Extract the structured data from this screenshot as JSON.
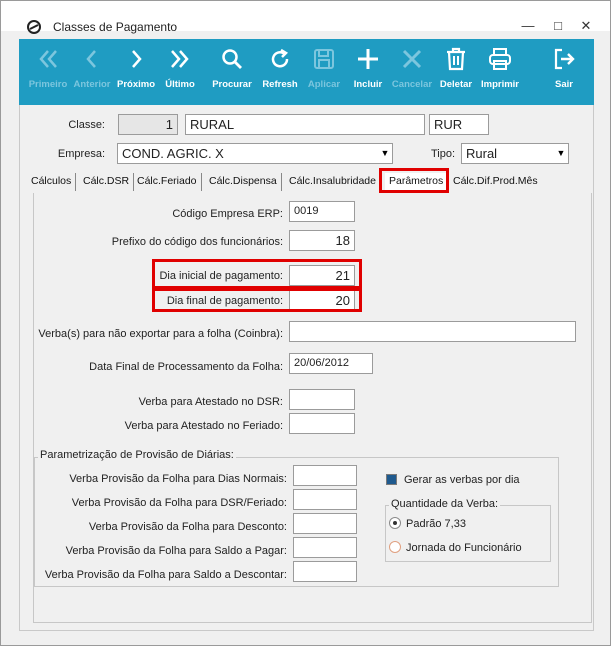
{
  "window": {
    "title": "Classes de Pagamento",
    "controls": {
      "minimize": "—",
      "maximize": "□",
      "close": "✕"
    }
  },
  "toolbar": {
    "buttons": [
      {
        "label": "Primeiro",
        "icon": "double-chevron-left-icon",
        "enabled": false
      },
      {
        "label": "Anterior",
        "icon": "chevron-left-icon",
        "enabled": false
      },
      {
        "label": "Próximo",
        "icon": "chevron-right-icon",
        "enabled": true
      },
      {
        "label": "Último",
        "icon": "double-chevron-right-icon",
        "enabled": true
      },
      {
        "label": "Procurar",
        "icon": "search-icon",
        "enabled": true
      },
      {
        "label": "Refresh",
        "icon": "refresh-icon",
        "enabled": true
      },
      {
        "label": "Aplicar",
        "icon": "save-icon",
        "enabled": false
      },
      {
        "label": "Incluir",
        "icon": "plus-icon",
        "enabled": true
      },
      {
        "label": "Cancelar",
        "icon": "close-icon",
        "enabled": false
      },
      {
        "label": "Deletar",
        "icon": "trash-icon",
        "enabled": true
      },
      {
        "label": "Imprimir",
        "icon": "printer-icon",
        "enabled": true
      },
      {
        "label": "Sair",
        "icon": "exit-icon",
        "enabled": true
      }
    ],
    "accent": "#1f9cc2"
  },
  "header": {
    "classe_label": "Classe:",
    "classe_code": "1",
    "classe_name": "RURAL",
    "classe_abbrev": "RUR",
    "empresa_label": "Empresa:",
    "empresa_value": "COND. AGRIC. X",
    "tipo_label": "Tipo:",
    "tipo_value": "Rural",
    "dropdown_arrow": "▼"
  },
  "tabs": [
    {
      "label": "Cálculos",
      "active": false
    },
    {
      "label": "Cálc.DSR",
      "active": false
    },
    {
      "label": "Cálc.Feriado",
      "active": false
    },
    {
      "label": "Cálc.Dispensa",
      "active": false
    },
    {
      "label": "Cálc.Insalubridade",
      "active": false
    },
    {
      "label": "Parâmetros",
      "active": true
    },
    {
      "label": "Cálc.Dif.Prod.Mês",
      "active": false
    }
  ],
  "parametros": {
    "codigo_empresa_label": "Código Empresa ERP:",
    "codigo_empresa_value": "0019",
    "prefixo_label": "Prefixo do código dos funcionários:",
    "prefixo_value": "18",
    "dia_inicial_label": "Dia inicial de pagamento:",
    "dia_inicial_value": "21",
    "dia_final_label": "Dia final de pagamento:",
    "dia_final_value": "20",
    "verbas_nao_exportar_label": "Verba(s) para não exportar para a folha (Coinbra):",
    "verbas_nao_exportar_value": "",
    "data_final_label": "Data Final de Processamento da Folha:",
    "data_final_value": "20/06/2012",
    "atestado_dsr_label": "Verba para Atestado no DSR:",
    "atestado_dsr_value": "",
    "atestado_feriado_label": "Verba para Atestado no Feriado:",
    "atestado_feriado_value": ""
  },
  "provisao": {
    "group_title": "Parametrização de Provisão de Diárias:",
    "dias_normais_label": "Verba Provisão da Folha para Dias Normais:",
    "dias_normais_value": "",
    "dsr_feriado_label": "Verba Provisão da Folha para DSR/Feriado:",
    "dsr_feriado_value": "",
    "desconto_label": "Verba Provisão da Folha para Desconto:",
    "desconto_value": "",
    "saldo_pagar_label": "Verba Provisão da Folha para Saldo a Pagar:",
    "saldo_pagar_value": "",
    "saldo_descontar_label": "Verba Provisão da Folha para Saldo a Descontar:",
    "saldo_descontar_value": "",
    "gerar_verbas_label": "Gerar as verbas por dia",
    "gerar_verbas_checked": true,
    "quantidade_title": "Quantidade da Verba:",
    "padrao_label": "Padrão 7,33",
    "padrao_selected": true,
    "jornada_label": "Jornada do Funcionário",
    "jornada_selected": false
  },
  "colors": {
    "highlight": "#e00000",
    "window_bg": "#f0f0f0"
  }
}
